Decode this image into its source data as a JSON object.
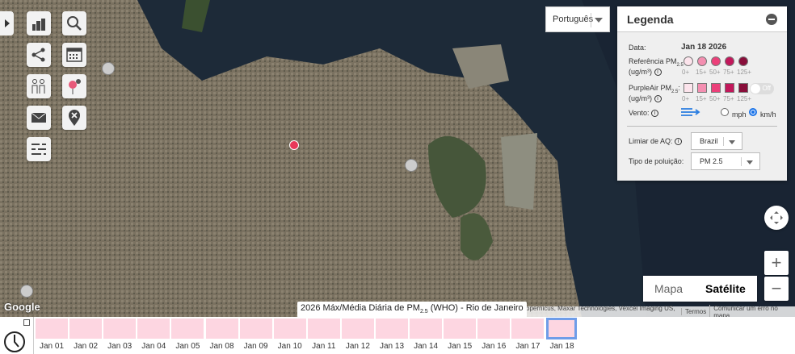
{
  "language": {
    "selected": "Português"
  },
  "toolbar": [
    {
      "name": "stats-icon"
    },
    {
      "name": "search-icon"
    },
    {
      "name": "share-icon"
    },
    {
      "name": "calendar-icon"
    },
    {
      "name": "people-icon"
    },
    {
      "name": "add-pin-icon"
    },
    {
      "name": "email-icon"
    },
    {
      "name": "remove-pin-icon"
    },
    {
      "name": "flow-icon"
    }
  ],
  "legend": {
    "title": "Legenda",
    "date_label": "Data:",
    "date_value": "Jan 18 2026",
    "ref_label": "Referência PM",
    "ref_sub": "2.5",
    "ref_unit": "(ug/m³)",
    "pa_label": "PurpleAir PM",
    "pa_sub": "2.5",
    "pa_unit": "(ug/m³)",
    "thresholds": [
      "0+",
      "15+",
      "50+",
      "75+",
      "125+"
    ],
    "colors": [
      "#fce4ec",
      "#f48fb1",
      "#ec407a",
      "#c2185b",
      "#880e3a"
    ],
    "toggle": "Off",
    "wind_label": "Vento:",
    "mph": "mph",
    "kmh": "km/h",
    "aq_label": "Limiar de AQ:",
    "aq_value": "Brazil",
    "pollution_label": "Tipo de poluição:",
    "pollution_value": "PM 2.5"
  },
  "map": {
    "type_map": "Mapa",
    "type_satellite": "Satélite",
    "google": "Google",
    "attribution": [
      "ndsat / Copernicus, Maxar Technologies, Vexcel Imaging US, Inc.",
      "Termos",
      "Comunicar um erro no mapa"
    ],
    "zoom_in": "+",
    "zoom_out": "−"
  },
  "tooltip": {
    "pre": "2026 Máx/Média Diária de PM",
    "sub": "2.5",
    "post": " (WHO) - Rio de Janeiro"
  },
  "timeline": {
    "days": [
      "Jan 01",
      "Jan 02",
      "Jan 03",
      "Jan 04",
      "Jan 05",
      "Jan 08",
      "Jan 09",
      "Jan 10",
      "Jan 11",
      "Jan 12",
      "Jan 13",
      "Jan 14",
      "Jan 15",
      "Jan 16",
      "Jan 17",
      "Jan 18"
    ],
    "selected": "Jan 18",
    "cell_color": "#fdd6e1"
  }
}
